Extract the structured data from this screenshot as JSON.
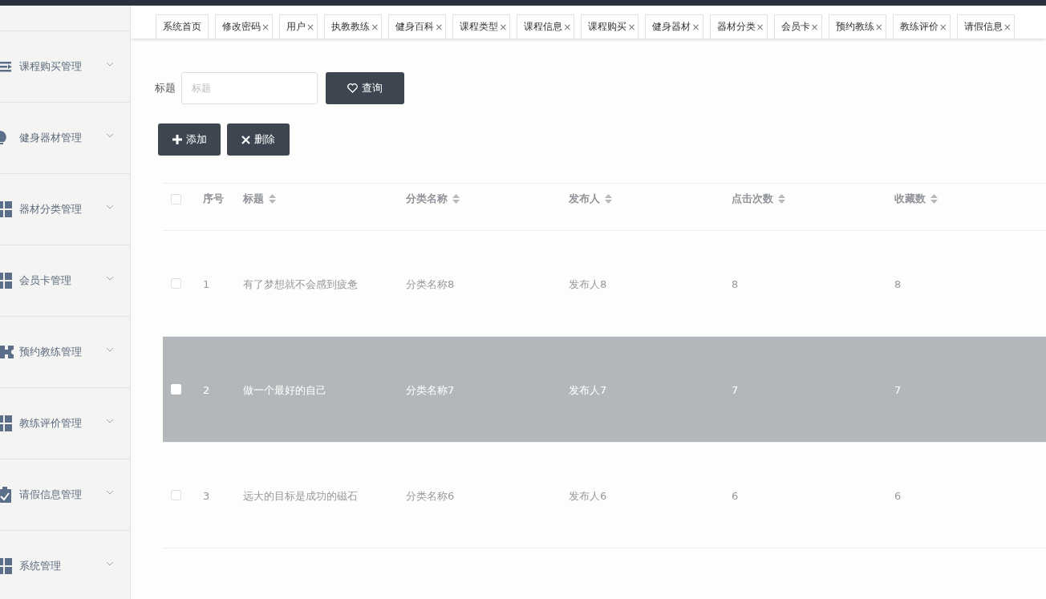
{
  "sidebar": {
    "items": [
      {
        "label": "课程购买管理",
        "kind": "list",
        "expanded": false
      },
      {
        "label": "健身器材管理",
        "kind": "bulb",
        "expanded": false
      },
      {
        "label": "器材分类管理",
        "kind": "grid",
        "expanded": false
      },
      {
        "label": "会员卡管理",
        "kind": "grid",
        "expanded": false
      },
      {
        "label": "预约教练管理",
        "kind": "ticket",
        "expanded": false
      },
      {
        "label": "教练评价管理",
        "kind": "grid",
        "expanded": false
      },
      {
        "label": "请假信息管理",
        "kind": "check",
        "expanded": false
      },
      {
        "label": "系统管理",
        "kind": "grid",
        "expanded": false
      }
    ]
  },
  "tabs": [
    {
      "label": "系统首页"
    },
    {
      "label": "修改密码",
      "close": "×"
    },
    {
      "label": "用户",
      "close": "×"
    },
    {
      "label": "执教教练",
      "close": "×"
    },
    {
      "label": "健身百科",
      "close": "×"
    },
    {
      "label": "课程类型",
      "close": "×"
    },
    {
      "label": "课程信息",
      "close": "×"
    },
    {
      "label": "课程购买",
      "close": "×"
    },
    {
      "label": "健身器材",
      "close": "×"
    },
    {
      "label": "器材分类",
      "close": "×"
    },
    {
      "label": "会员卡",
      "close": "×"
    },
    {
      "label": "预约教练",
      "close": "×"
    },
    {
      "label": "教练评价",
      "close": "×"
    },
    {
      "label": "请假信息",
      "close": "×"
    }
  ],
  "search": {
    "label": "标题",
    "placeholder": "标题",
    "button": "查询"
  },
  "actions": [
    {
      "kind": "add",
      "label": "添加"
    },
    {
      "kind": "delete",
      "label": "删除"
    }
  ],
  "table": {
    "all_checked": false,
    "columns": [
      {
        "label": "序号",
        "sortable": false
      },
      {
        "label": "标题",
        "sortable": true
      },
      {
        "label": "分类名称",
        "sortable": true
      },
      {
        "label": "发布人",
        "sortable": true
      },
      {
        "label": "点击次数",
        "sortable": true
      },
      {
        "label": "收藏数",
        "sortable": true
      }
    ],
    "rows": [
      {
        "selected": false,
        "checked": false,
        "cells": [
          "1",
          "有了梦想就不会感到疲惫",
          "分类名称8",
          "发布人8",
          "8",
          "8"
        ]
      },
      {
        "selected": true,
        "checked": false,
        "cells": [
          "2",
          "做一个最好的自己",
          "分类名称7",
          "发布人7",
          "7",
          "7"
        ]
      },
      {
        "selected": false,
        "checked": false,
        "cells": [
          "3",
          "远大的目标是成功的磁石",
          "分类名称6",
          "发布人6",
          "6",
          "6"
        ]
      }
    ]
  }
}
